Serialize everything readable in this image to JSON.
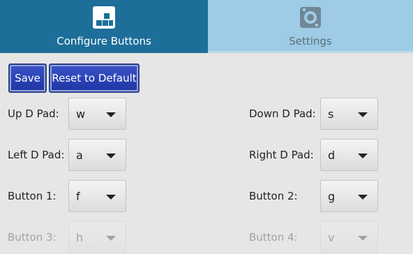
{
  "tabs": {
    "configure": {
      "label": "Configure Buttons",
      "icon": "grid-icon"
    },
    "settings": {
      "label": "Settings",
      "icon": "settings-icon"
    }
  },
  "actions": {
    "save_label": "Save",
    "reset_label": "Reset to Default"
  },
  "mappings": {
    "up": {
      "label": "Up D Pad:",
      "value": "w"
    },
    "down": {
      "label": "Down D Pad:",
      "value": "s"
    },
    "left": {
      "label": "Left D Pad:",
      "value": "a"
    },
    "right": {
      "label": "Right D Pad:",
      "value": "d"
    },
    "b1": {
      "label": "Button 1:",
      "value": "f"
    },
    "b2": {
      "label": "Button 2:",
      "value": "g"
    },
    "b3": {
      "label": "Button 3:",
      "value": "h"
    },
    "b4": {
      "label": "Button 4:",
      "value": "v"
    }
  },
  "colors": {
    "tab_active": "#1d6e99",
    "tab_inactive": "#9ecbe6",
    "button": "#2b44b8",
    "background": "#e6e6e6"
  }
}
